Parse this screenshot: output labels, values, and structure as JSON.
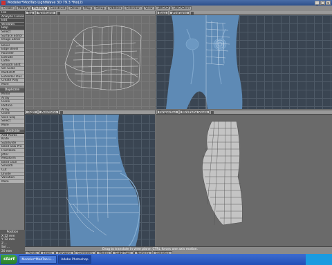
{
  "window": {
    "title": "Modeler*ModTab LightWave 3D 79.3 *No(2)",
    "buttons": [
      "_",
      "□",
      "x"
    ]
  },
  "tabs": [
    {
      "label": "Create",
      "active": false
    },
    {
      "label": "Modify",
      "active": false
    },
    {
      "label": "Multiply",
      "active": true
    },
    {
      "label": "Construct",
      "active": false
    },
    {
      "label": "Detail",
      "active": false
    },
    {
      "label": "Map",
      "active": false
    },
    {
      "label": "Setup",
      "active": false
    },
    {
      "label": "Utilities",
      "active": false
    },
    {
      "label": "Selection",
      "active": false
    },
    {
      "label": "View",
      "active": false
    },
    {
      "label": "LWCAD",
      "active": false
    },
    {
      "label": "LWCADext",
      "active": false
    }
  ],
  "sidebar": {
    "top_items": [
      "File",
      "Analyze Curves",
      "Edit",
      "Windows",
      "Help",
      "Select",
      "Surface Editor",
      "Image Editor"
    ],
    "group1_items": [
      "Bevel",
      "Edge Bevel",
      "Rounder",
      "Extrude",
      "Lathe",
      "Smooth Shift",
      "Sm Scale",
      "Multishift",
      "Extender Plus",
      "Create Poly",
      "More"
    ],
    "duplicate_title": "Duplicate",
    "duplicate_items": [
      "Mirror",
      "Array",
      "Clone",
      "Particle",
      "Array",
      "Clone",
      "Slice Seq",
      "Select",
      "More"
    ],
    "subdivide_title": "Subdivide",
    "subdivide_items": [
      "Add Points",
      "Knife",
      "Subdivide",
      "Band Saw Pro",
      "Fractalize",
      "Jitter",
      "Metaform",
      "Band Glue",
      "Smooth",
      "Cut",
      "Divide",
      "Variation",
      "More"
    ],
    "position_title": "Position",
    "position_rows": [
      "X   12 mm",
      "Y   12 mm",
      "Z   ...",
      "Sel  ..."
    ],
    "grid_label": "20 mm"
  },
  "viewports": {
    "top": {
      "label": "Top",
      "mode": "Wireframe"
    },
    "back": {
      "label": "Back",
      "mode": "Wireframe"
    },
    "right": {
      "label": "Right",
      "mode": "Wireframe"
    },
    "perspective": {
      "label": "Perspective",
      "mode": "Wireframe Shade"
    }
  },
  "status": {
    "hint": "Drag to translate in view plane. CTRL forces one axis motion.",
    "buttons": [
      "Points",
      "Edges",
      "Polygons",
      "Symmetry",
      "Modes",
      "SubD-Type",
      "Numeric",
      "Statistics"
    ]
  },
  "taskbar": {
    "start_label": "start",
    "items": [
      {
        "label": "Modeler*ModTab Li...",
        "active": false
      },
      {
        "label": "Adobe Photoshop",
        "active": true
      }
    ]
  },
  "colors": {
    "viewport_bg": "#3a4552",
    "skin_blue": "#5e8ab5",
    "wire_white": "#e8e8e8",
    "ui_gray": "#9a9a9a"
  }
}
